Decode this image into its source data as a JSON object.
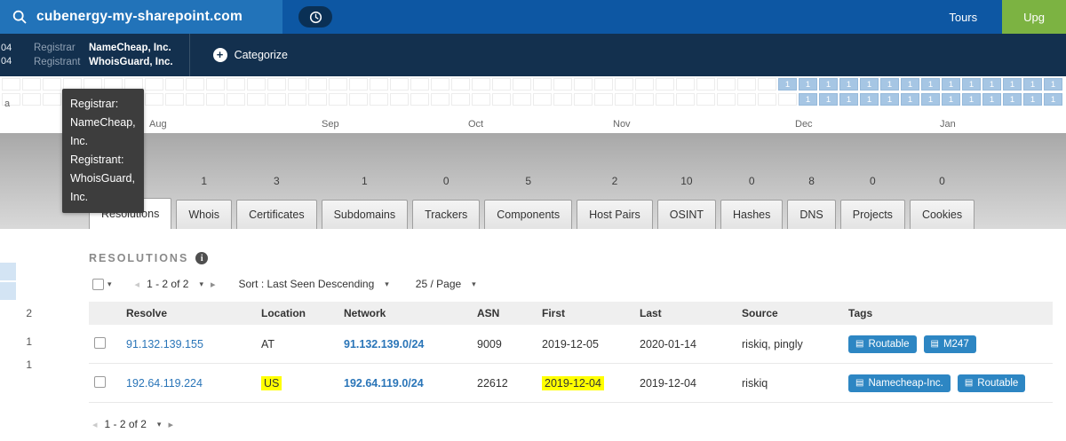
{
  "topbar": {
    "search": {
      "value": "cubenergy-my-sharepoint.com"
    },
    "tours": "Tours",
    "upgrade": "Upg"
  },
  "infobar": {
    "cut_lines": [
      "04",
      "04"
    ],
    "fields": [
      {
        "label": "Registrar",
        "value": "NameCheap, Inc."
      },
      {
        "label": "Registrant",
        "value": "WhoisGuard, Inc."
      }
    ],
    "categorize": "Categorize"
  },
  "tooltip": {
    "lines": [
      "Registrar:",
      "NameCheap,",
      "Inc.",
      "Registrant:",
      "WhoisGuard,",
      "Inc."
    ]
  },
  "heatmap": {
    "months": [
      "Aug",
      "Sep",
      "Oct",
      "Nov",
      "Dec",
      "Jan"
    ],
    "left_cut_label": "a",
    "columns": 52,
    "row_highlight_counts": [
      14,
      13
    ],
    "cell_value": "1"
  },
  "tabs": {
    "items": [
      {
        "label": "Resolutions",
        "count": "",
        "active": true
      },
      {
        "label": "Whois",
        "count": "1",
        "active": false
      },
      {
        "label": "Certificates",
        "count": "3",
        "active": false
      },
      {
        "label": "Subdomains",
        "count": "1",
        "active": false
      },
      {
        "label": "Trackers",
        "count": "0",
        "active": false
      },
      {
        "label": "Components",
        "count": "5",
        "active": false
      },
      {
        "label": "Host Pairs",
        "count": "2",
        "active": false
      },
      {
        "label": "OSINT",
        "count": "10",
        "active": false
      },
      {
        "label": "Hashes",
        "count": "0",
        "active": false
      },
      {
        "label": "DNS",
        "count": "8",
        "active": false
      },
      {
        "label": "Projects",
        "count": "0",
        "active": false
      },
      {
        "label": "Cookies",
        "count": "0",
        "active": false
      }
    ]
  },
  "left_edge": {
    "numbers": [
      "2",
      "1",
      "1"
    ]
  },
  "resolutions": {
    "title": "RESOLUTIONS",
    "pagination": "1 - 2 of 2",
    "sort_label": "Sort : Last Seen Descending",
    "page_size": "25 / Page",
    "columns": [
      "Resolve",
      "Location",
      "Network",
      "ASN",
      "First",
      "Last",
      "Source",
      "Tags"
    ],
    "rows": [
      {
        "resolve": "91.132.139.155",
        "location": "AT",
        "location_highlight": false,
        "network": "91.132.139.0/24",
        "asn": "9009",
        "first": "2019-12-05",
        "first_highlight": false,
        "last": "2020-01-14",
        "source": "riskiq, pingly",
        "tags": [
          "Routable",
          "M247"
        ]
      },
      {
        "resolve": "192.64.119.224",
        "location": "US",
        "location_highlight": true,
        "network": "192.64.119.0/24",
        "asn": "22612",
        "first": "2019-12-04",
        "first_highlight": true,
        "last": "2019-12-04",
        "source": "riskiq",
        "tags": [
          "Namecheap-Inc.",
          "Routable"
        ]
      }
    ],
    "footer_pagination": "1 - 2 of 2"
  },
  "glyphs": {
    "caret_down": "▾",
    "arrow_left": "◂",
    "arrow_right": "▸",
    "tag_icon": "▤",
    "plus": "+",
    "info": "i"
  },
  "colors": {
    "topbar": "#0d57a3",
    "search_area": "#2273b9",
    "infobar": "#13304e",
    "accent_green": "#7cb342",
    "link_blue": "#2a75b8",
    "tag_blue": "#2d86c3",
    "highlight_yellow": "#ffff00",
    "heatmap_cell_blue": "#a6c6e4",
    "tooltip_bg": "#3d3d3d"
  }
}
